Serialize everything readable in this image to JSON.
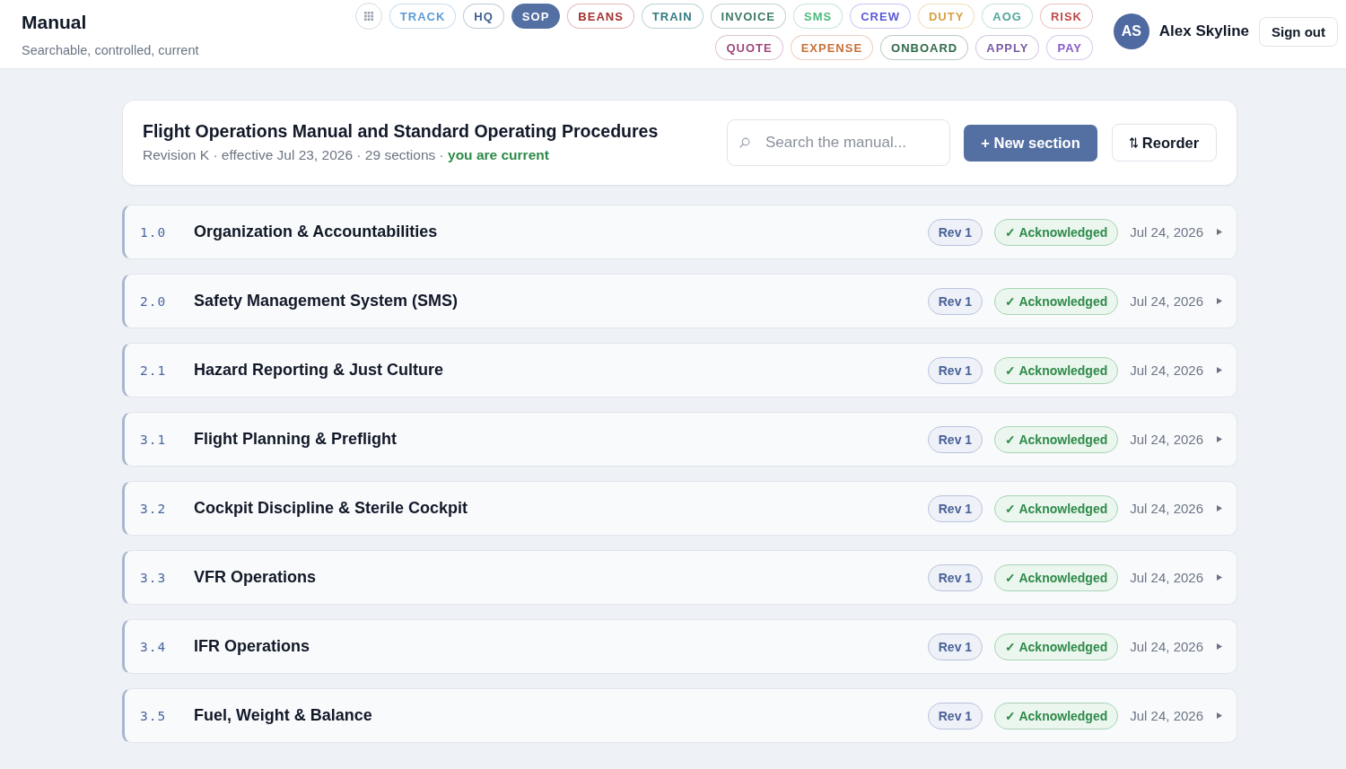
{
  "header": {
    "title": "Manual",
    "subtitle": "Searchable, controlled, current"
  },
  "nav": {
    "apps": [
      {
        "label": "TRACK",
        "color": "#5b9bd5",
        "selected": false
      },
      {
        "label": "HQ",
        "color": "#3d5f8f",
        "selected": false
      },
      {
        "label": "SOP",
        "color": "#5470a3",
        "selected": true
      },
      {
        "label": "BEANS",
        "color": "#a3302e",
        "selected": false
      },
      {
        "label": "TRAIN",
        "color": "#2f7a80",
        "selected": false
      },
      {
        "label": "INVOICE",
        "color": "#3e7a66",
        "selected": false
      },
      {
        "label": "SMS",
        "color": "#4cbb7a",
        "selected": false
      },
      {
        "label": "CREW",
        "color": "#5b5bd6",
        "selected": false
      },
      {
        "label": "DUTY",
        "color": "#d8a040",
        "selected": false
      },
      {
        "label": "AOG",
        "color": "#4fa89a",
        "selected": false
      },
      {
        "label": "RISK",
        "color": "#c04848",
        "selected": false
      },
      {
        "label": "QUOTE",
        "color": "#a0487e",
        "selected": false
      },
      {
        "label": "EXPENSE",
        "color": "#c87038",
        "selected": false
      },
      {
        "label": "ONBOARD",
        "color": "#2f6a48",
        "selected": false
      },
      {
        "label": "APPLY",
        "color": "#7a5aa8",
        "selected": false
      },
      {
        "label": "PAY",
        "color": "#8a5ac8",
        "selected": false
      }
    ]
  },
  "user": {
    "initials": "AS",
    "name": "Alex Skyline",
    "sign_out": "Sign out"
  },
  "manual": {
    "title": "Flight Operations Manual and Standard Operating Procedures",
    "meta": "Revision K · effective Jul 23, 2026 · 29 sections · **you are current**",
    "search": {
      "placeholder": "Search the manual..."
    },
    "new_section": "+ New section",
    "reorder": "Reorder"
  },
  "sections": [
    {
      "number": "1.0",
      "title": "Organization & Accountabilities",
      "revision": "Rev 1",
      "status": "✓ Acknowledged",
      "date": "Jul 24, 2026",
      "expanded": false
    },
    {
      "number": "2.0",
      "title": "Safety Management System (SMS)",
      "revision": "Rev 1",
      "status": "✓ Acknowledged",
      "date": "Jul 24, 2026",
      "expanded": false
    },
    {
      "number": "2.1",
      "title": "Hazard Reporting & Just Culture",
      "revision": "Rev 1",
      "status": "✓ Acknowledged",
      "date": "Jul 24, 2026",
      "expanded": false
    },
    {
      "number": "3.1",
      "title": "Flight Planning & Preflight",
      "revision": "Rev 1",
      "status": "✓ Acknowledged",
      "date": "Jul 24, 2026",
      "expanded": false
    },
    {
      "number": "3.2",
      "title": "Cockpit Discipline & Sterile Cockpit",
      "revision": "Rev 1",
      "status": "✓ Acknowledged",
      "date": "Jul 24, 2026",
      "expanded": false
    },
    {
      "number": "3.3",
      "title": "VFR Operations",
      "revision": "Rev 1",
      "status": "✓ Acknowledged",
      "date": "Jul 24, 2026",
      "expanded": false
    },
    {
      "number": "3.4",
      "title": "IFR Operations",
      "revision": "Rev 1",
      "status": "✓ Acknowledged",
      "date": "Jul 24, 2026",
      "expanded": false
    },
    {
      "number": "3.5",
      "title": "Fuel, Weight & Balance",
      "revision": "Rev 1",
      "status": "✓ Acknowledged",
      "date": "Jul 24, 2026",
      "expanded": false
    }
  ]
}
